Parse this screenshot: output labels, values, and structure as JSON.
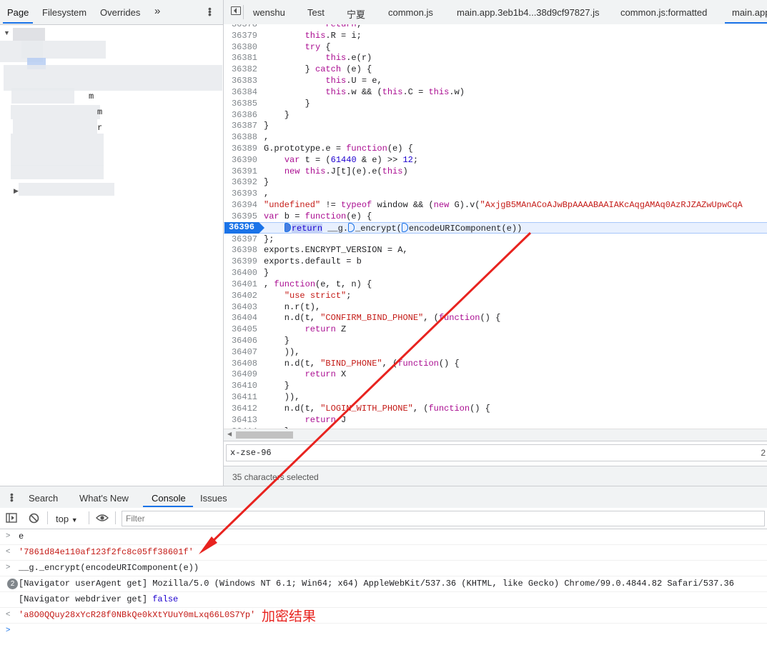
{
  "navigator": {
    "tabs": [
      "Page",
      "Filesystem",
      "Overrides"
    ],
    "more": "»",
    "tree_fragments": [
      "m",
      "m",
      "r"
    ]
  },
  "editor": {
    "tabs": [
      "wenshu",
      "Test",
      "宁夏",
      "common.js",
      "main.app.3eb1b4...38d9cf97827.js",
      "common.js:formatted",
      "main.app"
    ]
  },
  "code": {
    "lines": [
      {
        "n": "36378",
        "html": "<span class='kw'>return</span>;"
      },
      {
        "n": "36379",
        "html": "        <span class='kw'>this</span>.R = i;"
      },
      {
        "n": "36380",
        "html": "        <span class='kw'>try</span> {"
      },
      {
        "n": "36381",
        "html": "            <span class='kw'>this</span>.e(r)"
      },
      {
        "n": "36382",
        "html": "        } <span class='kw'>catch</span> (e) {"
      },
      {
        "n": "36383",
        "html": "            <span class='kw'>this</span>.U = e,"
      },
      {
        "n": "36384",
        "html": "            <span class='kw'>this</span>.w &amp;&amp; (<span class='kw'>this</span>.C = <span class='kw'>this</span>.w)"
      },
      {
        "n": "36385",
        "html": "        }"
      },
      {
        "n": "36386",
        "html": "    }"
      },
      {
        "n": "36387",
        "html": "}"
      },
      {
        "n": "36388",
        "html": ","
      },
      {
        "n": "36389",
        "html": "G.prototype.e = <span class='kw'>function</span>(e) {"
      },
      {
        "n": "36390",
        "html": "    <span class='kw'>var</span> t = (<span class='num'>61440</span> &amp; e) &gt;&gt; <span class='num'>12</span>;"
      },
      {
        "n": "36391",
        "html": "    <span class='kw'>new</span> <span class='kw'>this</span>.J[t](e).e(<span class='kw'>this</span>)"
      },
      {
        "n": "36392",
        "html": "}"
      },
      {
        "n": "36393",
        "html": ","
      },
      {
        "n": "36394",
        "html": "<span class='str'>\"undefined\"</span> != <span class='kw'>typeof</span> window &amp;&amp; (<span class='kw'>new</span> G).v(<span class='str'>\"AxjgB5MAnACoAJwBpAAAABAAIAKcAqgAMAq0AzRJZAZwUpwCqA</span>"
      },
      {
        "n": "36395",
        "html": "<span class='kw'>var</span> b = <span class='kw'>function</span>(e) {"
      },
      {
        "n": "36396",
        "html": "    <span class='marker fill'></span><span class='sel'>return</span> __g.<span class='marker'></span>_encrypt(<span class='marker'></span>encodeURIComponent(e))",
        "highlight": true
      },
      {
        "n": "36397",
        "html": "};"
      },
      {
        "n": "36398",
        "html": "exports.ENCRYPT_VERSION = A,"
      },
      {
        "n": "36399",
        "html": "exports.default = b"
      },
      {
        "n": "36400",
        "html": "}"
      },
      {
        "n": "36401",
        "html": ", <span class='kw'>function</span>(e, t, n) {"
      },
      {
        "n": "36402",
        "html": "    <span class='str'>\"use strict\"</span>;"
      },
      {
        "n": "36403",
        "html": "    n.r(t),"
      },
      {
        "n": "36404",
        "html": "    n.d(t, <span class='str'>\"CONFIRM_BIND_PHONE\"</span>, (<span class='kw'>function</span>() {"
      },
      {
        "n": "36405",
        "html": "        <span class='kw'>return</span> Z"
      },
      {
        "n": "36406",
        "html": "    }"
      },
      {
        "n": "36407",
        "html": "    )),"
      },
      {
        "n": "36408",
        "html": "    n.d(t, <span class='str'>\"BIND_PHONE\"</span>, (<span class='kw'>function</span>() {"
      },
      {
        "n": "36409",
        "html": "        <span class='kw'>return</span> X"
      },
      {
        "n": "36410",
        "html": "    }"
      },
      {
        "n": "36411",
        "html": "    )),"
      },
      {
        "n": "36412",
        "html": "    n.d(t, <span class='str'>\"LOGIN_WITH_PHONE\"</span>, (<span class='kw'>function</span>() {"
      },
      {
        "n": "36413",
        "html": "        <span class='kw'>return</span> J"
      },
      {
        "n": "36414",
        "html": "    }"
      }
    ]
  },
  "search": {
    "value": "x-zse-96",
    "count": "2"
  },
  "status": {
    "text": "35 characters selected"
  },
  "drawer": {
    "tabs": [
      "Search",
      "What's New",
      "Console",
      "Issues"
    ]
  },
  "console_toolbar": {
    "context": "top",
    "filter_placeholder": "Filter"
  },
  "console": {
    "lines": [
      {
        "icon": ">",
        "text": "e",
        "style": "input"
      },
      {
        "icon": "<",
        "text": "'7861d84e110af123f2fc8c05ff38601f'",
        "style": "result"
      },
      {
        "icon": ">",
        "text": "__g._encrypt(encodeURIComponent(e))",
        "style": "input"
      },
      {
        "badge": "2",
        "text": "[Navigator userAgent get] Mozilla/5.0 (Windows NT 6.1; Win64; x64) AppleWebKit/537.36 (KHTML, like Gecko) Chrome/99.0.4844.82 Safari/537.36",
        "style": "log"
      },
      {
        "text_prefix": "[Navigator webdriver get] ",
        "text_value": "false",
        "style": "log2"
      },
      {
        "icon": "<",
        "text": "'a8O0QQuy28xYcR28f0NBkQe0kXtYUuY0mLxq66L0S7Yp'",
        "style": "result"
      },
      {
        "icon": ">",
        "text": "",
        "style": "prompt"
      }
    ],
    "annotation": "加密结果"
  },
  "colors": {
    "accent": "#1a73e8",
    "arrow": "#e8231f",
    "string": "#c41a16"
  }
}
